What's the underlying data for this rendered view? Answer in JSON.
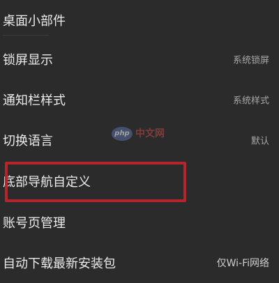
{
  "settings": {
    "items": [
      {
        "label": "桌面小部件",
        "value": ""
      },
      {
        "label": "锁屏显示",
        "value": "系统锁屏"
      },
      {
        "label": "通知栏样式",
        "value": "系统样式"
      },
      {
        "label": "切换语言",
        "value": "默认"
      },
      {
        "label": "底部导航自定义",
        "value": ""
      },
      {
        "label": "账号页管理",
        "value": ""
      },
      {
        "label": "自动下载最新安装包",
        "value": "仅Wi-Fi网络"
      }
    ]
  },
  "watermark": {
    "badge": "php",
    "text": "中文网"
  },
  "colors": {
    "background": "#2b2b2b",
    "highlight": "#b3262b"
  }
}
